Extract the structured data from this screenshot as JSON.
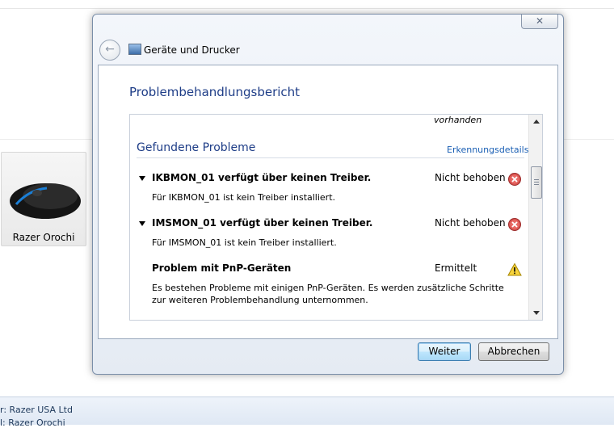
{
  "background": {
    "device": {
      "label": "Razer Orochi"
    },
    "details": [
      {
        "label": "r:",
        "value": "Razer USA Ltd"
      },
      {
        "label": "l:",
        "value": "Razer Orochi"
      }
    ]
  },
  "dialog": {
    "breadcrumb": "Geräte und Drucker",
    "title": "Problembehandlungsbericht",
    "fragment": "vorhanden",
    "section": {
      "heading": "Gefundene Probleme",
      "link": "Erkennungsdetails"
    },
    "problems": [
      {
        "title": "IKBMON_01 verfügt über keinen Treiber.",
        "desc": "Für IKBMON_01 ist kein Treiber installiert.",
        "status": "Nicht behoben",
        "icon": "error-icon",
        "expandable": true
      },
      {
        "title": "IMSMON_01 verfügt über keinen Treiber.",
        "desc": "Für IMSMON_01 ist kein Treiber installiert.",
        "status": "Nicht behoben",
        "icon": "error-icon",
        "expandable": true
      },
      {
        "title": "Problem mit PnP-Geräten",
        "desc": "Es bestehen Probleme mit einigen PnP-Geräten. Es werden zusätzliche Schritte zur weiteren Problembehandlung unternommen.",
        "status": "Ermittelt",
        "icon": "warning-icon",
        "expandable": false
      }
    ],
    "buttons": {
      "next": "Weiter",
      "cancel": "Abbrechen"
    },
    "colors": {
      "title": "#1e3d87",
      "link": "#1a5fb4",
      "error": "#c83030",
      "warning": "#f2c200"
    }
  }
}
